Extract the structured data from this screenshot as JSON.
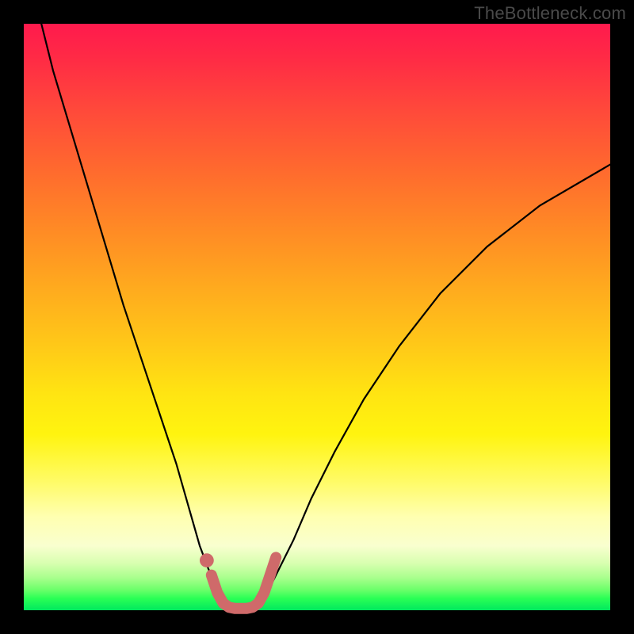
{
  "watermark": "TheBottleneck.com",
  "chart_data": {
    "type": "line",
    "title": "",
    "xlabel": "",
    "ylabel": "",
    "xlim": [
      0,
      100
    ],
    "ylim": [
      0,
      100
    ],
    "grid": false,
    "annotations": [],
    "series": [
      {
        "name": "left-curve",
        "color": "#000000",
        "x": [
          3,
          5,
          8,
          11,
          14,
          17,
          20,
          23,
          26,
          28,
          30,
          31.5,
          33,
          34,
          35
        ],
        "y": [
          100,
          92,
          82,
          72,
          62,
          52,
          43,
          34,
          25,
          18,
          11,
          7,
          4,
          2,
          0.5
        ]
      },
      {
        "name": "right-curve",
        "color": "#000000",
        "x": [
          40,
          41.5,
          43.5,
          46,
          49,
          53,
          58,
          64,
          71,
          79,
          88,
          100
        ],
        "y": [
          0.5,
          3,
          7,
          12,
          19,
          27,
          36,
          45,
          54,
          62,
          69,
          76
        ]
      },
      {
        "name": "bottleneck-highlight",
        "color": "#cf6a6a",
        "x": [
          32,
          33,
          34,
          35,
          36,
          37,
          38,
          39,
          40,
          41,
          42,
          43
        ],
        "y": [
          6,
          3,
          1.2,
          0.5,
          0.3,
          0.3,
          0.3,
          0.5,
          1.2,
          3,
          6,
          9
        ]
      }
    ],
    "markers": [
      {
        "name": "highlight-dot",
        "x": 31.2,
        "y": 8.5,
        "color": "#cf6a6a",
        "r": 1.2
      }
    ]
  }
}
